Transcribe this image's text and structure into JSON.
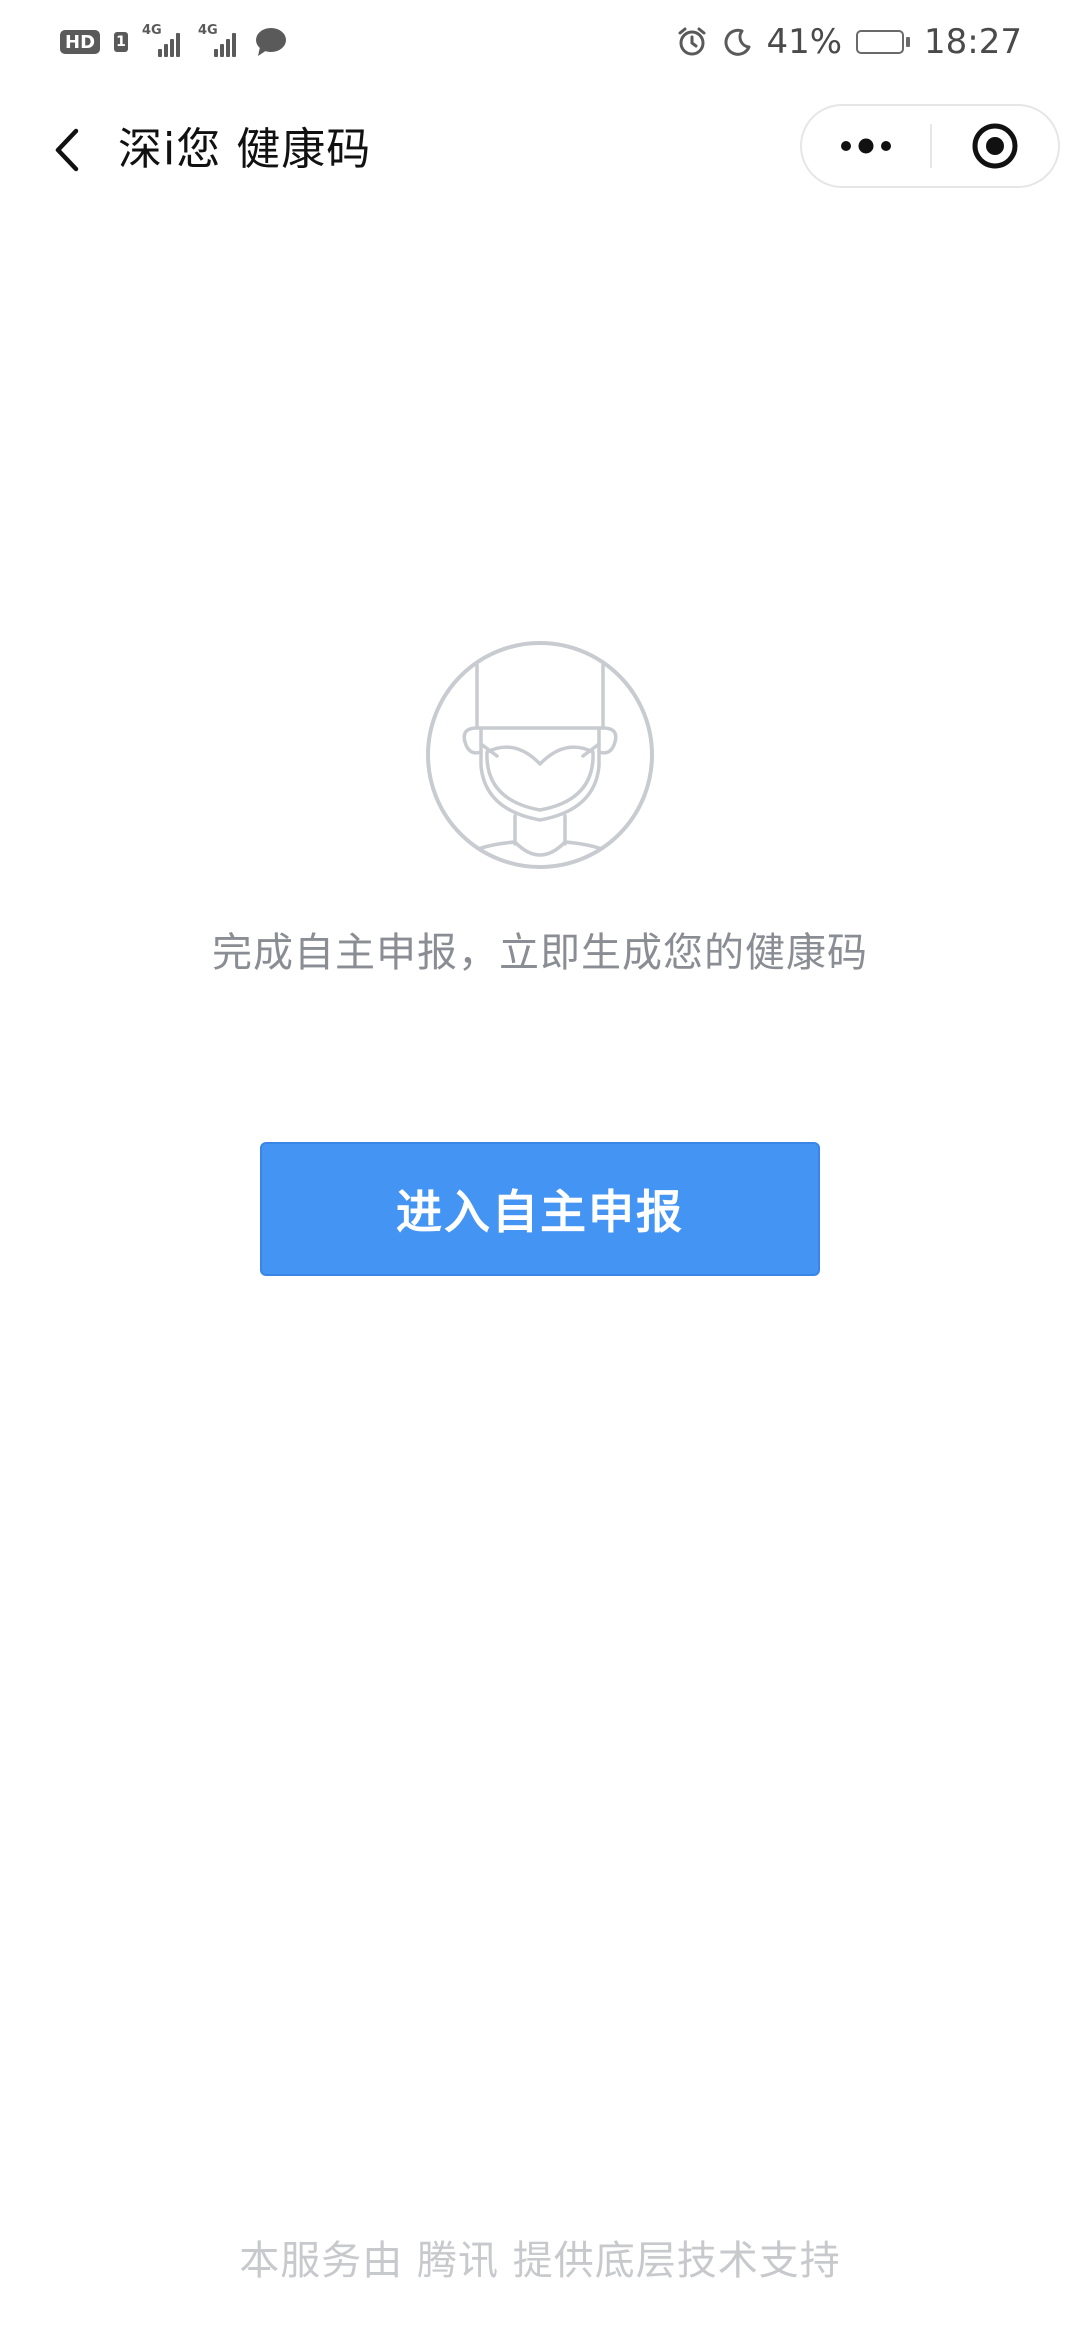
{
  "status_bar": {
    "hd_label": "HD",
    "sim_label": "1",
    "network_1": "4G",
    "network_2": "4G",
    "battery_percent_text": "41%",
    "battery_level": 0.41,
    "time": "18:27",
    "icons": [
      "hd-icon",
      "signal-icon",
      "signal-icon",
      "message-bubble-icon",
      "alarm-icon",
      "moon-icon",
      "battery-icon"
    ]
  },
  "nav": {
    "title": "深i您 健康码",
    "back_icon": "chevron-left-icon",
    "more_icon": "more-dots-icon",
    "close_icon": "target-close-icon"
  },
  "main": {
    "avatar_icon": "masked-person-icon",
    "prompt": "完成自主申报，立即生成您的健康码",
    "button_label": "进入自主申报"
  },
  "footer": {
    "text": "本服务由 腾讯 提供底层技术支持"
  },
  "colors": {
    "primary": "#4494f3",
    "prompt_text": "#8a8d93",
    "footer_text": "#c7c9cc",
    "avatar_line": "#c8cbd0"
  }
}
